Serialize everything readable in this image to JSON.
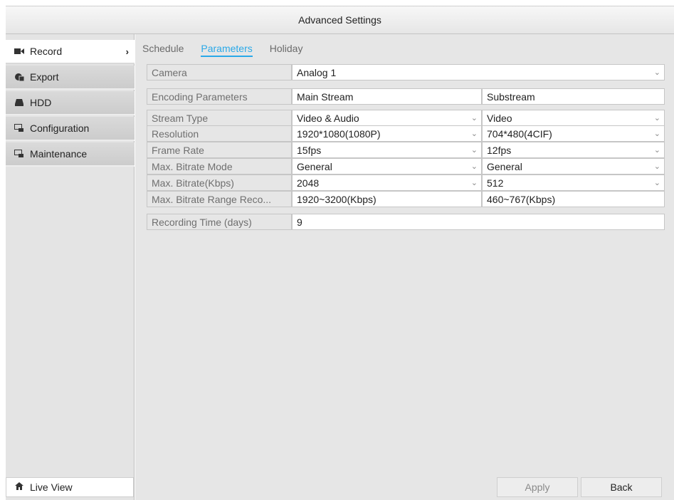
{
  "window": {
    "title": "Advanced Settings"
  },
  "sidebar": {
    "items": [
      {
        "label": "Record",
        "icon": "video-camera-icon",
        "active": true
      },
      {
        "label": "Export",
        "icon": "export-icon"
      },
      {
        "label": "HDD",
        "icon": "hdd-icon"
      },
      {
        "label": "Configuration",
        "icon": "configuration-icon"
      },
      {
        "label": "Maintenance",
        "icon": "maintenance-icon"
      }
    ],
    "live_view": {
      "label": "Live View",
      "icon": "home-icon"
    }
  },
  "tabs": [
    {
      "label": "Schedule"
    },
    {
      "label": "Parameters",
      "active": true
    },
    {
      "label": "Holiday"
    }
  ],
  "camera": {
    "label": "Camera",
    "value": "Analog 1"
  },
  "table": {
    "header": {
      "label": "Encoding Parameters",
      "main": "Main Stream",
      "sub": "Substream"
    },
    "rows": [
      {
        "label": "Stream Type",
        "main": "Video & Audio",
        "sub": "Video",
        "dropdown": true
      },
      {
        "label": "Resolution",
        "main": "1920*1080(1080P)",
        "sub": "704*480(4CIF)",
        "dropdown": true
      },
      {
        "label": "Frame Rate",
        "main": "15fps",
        "sub": "12fps",
        "dropdown": true
      },
      {
        "label": "Max. Bitrate Mode",
        "main": "General",
        "sub": "General",
        "dropdown": true
      },
      {
        "label": "Max. Bitrate(Kbps)",
        "main": "2048",
        "sub": "512",
        "dropdown": true
      },
      {
        "label": "Max. Bitrate Range Reco...",
        "main": "1920~3200(Kbps)",
        "sub": "460~767(Kbps)",
        "dropdown": false
      }
    ]
  },
  "recording_time": {
    "label": "Recording Time (days)",
    "value": "9"
  },
  "buttons": {
    "apply": "Apply",
    "back": "Back"
  },
  "colors": {
    "accent": "#2aa9e8",
    "panel": "#e6e6e6",
    "sidebar_item": "#cccccc"
  }
}
